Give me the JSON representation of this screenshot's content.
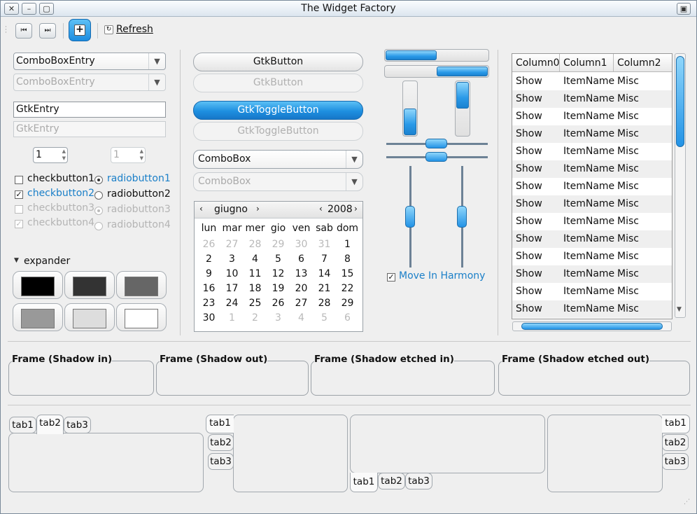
{
  "window": {
    "title": "The Widget Factory"
  },
  "toolbar": {
    "refresh_label": "Refresh"
  },
  "left": {
    "combo_entry": "ComboBoxEntry",
    "combo_entry_disabled": "ComboBoxEntry",
    "entry": "GtkEntry",
    "entry_disabled": "GtkEntry",
    "spin": "1",
    "spin_disabled": "1",
    "checks": [
      "checkbutton1",
      "checkbutton2",
      "checkbutton3",
      "checkbutton4"
    ],
    "radios": [
      "radiobutton1",
      "radiobutton2",
      "radiobutton3",
      "radiobutton4"
    ],
    "expander": "expander",
    "colors": [
      "#000000",
      "#333333",
      "#666666",
      "#999999",
      "#dddddd",
      "#ffffff"
    ]
  },
  "middle": {
    "button": "GtkButton",
    "button_disabled": "GtkButton",
    "toggle": "GtkToggleButton",
    "toggle_disabled": "GtkToggleButton",
    "combo": "ComboBox",
    "combo_disabled": "ComboBox",
    "calendar": {
      "month": "giugno",
      "year": "2008",
      "weekdays": [
        "lun",
        "mar",
        "mer",
        "gio",
        "ven",
        "sab",
        "dom"
      ],
      "days": [
        [
          "26",
          "27",
          "28",
          "29",
          "30",
          "31",
          "1"
        ],
        [
          "2",
          "3",
          "4",
          "5",
          "6",
          "7",
          "8"
        ],
        [
          "9",
          "10",
          "11",
          "12",
          "13",
          "14",
          "15"
        ],
        [
          "16",
          "17",
          "18",
          "19",
          "20",
          "21",
          "22"
        ],
        [
          "23",
          "24",
          "25",
          "26",
          "27",
          "28",
          "29"
        ],
        [
          "30",
          "1",
          "2",
          "3",
          "4",
          "5",
          "6"
        ]
      ]
    }
  },
  "sliders": {
    "move_in_harmony": "Move In Harmony",
    "progress_1": 0.5,
    "progress_2": 0.5
  },
  "tree": {
    "columns": [
      "Column0",
      "Column1",
      "Column2"
    ],
    "rows": [
      [
        "Show",
        "ItemName",
        "Misc"
      ],
      [
        "Show",
        "ItemName",
        "Misc"
      ],
      [
        "Show",
        "ItemName",
        "Misc"
      ],
      [
        "Show",
        "ItemName",
        "Misc"
      ],
      [
        "Show",
        "ItemName",
        "Misc"
      ],
      [
        "Show",
        "ItemName",
        "Misc"
      ],
      [
        "Show",
        "ItemName",
        "Misc"
      ],
      [
        "Show",
        "ItemName",
        "Misc"
      ],
      [
        "Show",
        "ItemName",
        "Misc"
      ],
      [
        "Show",
        "ItemName",
        "Misc"
      ],
      [
        "Show",
        "ItemName",
        "Misc"
      ],
      [
        "Show",
        "ItemName",
        "Misc"
      ],
      [
        "Show",
        "ItemName",
        "Misc"
      ],
      [
        "Show",
        "ItemName",
        "Misc"
      ]
    ]
  },
  "frames": [
    "Frame (Shadow in)",
    "Frame (Shadow out)",
    "Frame (Shadow etched in)",
    "Frame (Shadow etched out)"
  ],
  "tabs": [
    "tab1",
    "tab2",
    "tab3"
  ],
  "colors": {
    "accent": "#1a7fc8"
  }
}
